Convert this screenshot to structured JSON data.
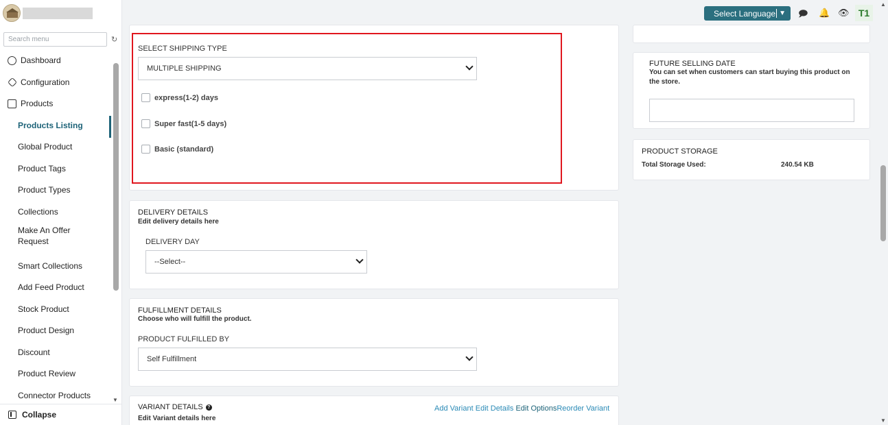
{
  "sidebar": {
    "search_placeholder": "Search menu",
    "items": [
      {
        "label": "Dashboard",
        "icon": "dashboard-icon"
      },
      {
        "label": "Configuration",
        "icon": "configuration-icon"
      },
      {
        "label": "Products",
        "icon": "products-icon"
      },
      {
        "label": "Products Listing",
        "active": true
      },
      {
        "label": "Global Product"
      },
      {
        "label": "Product Tags"
      },
      {
        "label": "Product Types"
      },
      {
        "label": "Collections"
      },
      {
        "label": "Make An Offer Request"
      },
      {
        "label": "Smart Collections"
      },
      {
        "label": "Add Feed Product"
      },
      {
        "label": "Stock Product"
      },
      {
        "label": "Product Design"
      },
      {
        "label": "Discount"
      },
      {
        "label": "Product Review"
      },
      {
        "label": "Connector Products"
      }
    ],
    "collapse_label": "Collapse"
  },
  "topbar": {
    "language_button": "Select Language",
    "avatar_initials": "T1"
  },
  "shipping": {
    "label": "SELECT SHIPPING TYPE",
    "selected": "MULTIPLE SHIPPING",
    "options": [
      {
        "label": "express(1-2) days",
        "checked": false
      },
      {
        "label": "Super fast(1-5 days)",
        "checked": false
      },
      {
        "label": "Basic (standard)",
        "checked": false
      }
    ]
  },
  "delivery": {
    "title": "DELIVERY DETAILS",
    "subtitle": "Edit delivery details here",
    "day_label": "DELIVERY DAY",
    "day_selected": "--Select--"
  },
  "fulfillment": {
    "title": "FULFILLMENT DETAILS",
    "subtitle": "Choose who will fulfill the product.",
    "by_label": "PRODUCT FULFILLED BY",
    "by_selected": "Self Fulfillment"
  },
  "variant": {
    "title": "VARIANT DETAILS",
    "subtitle": "Edit Variant details here",
    "add_variant": "Add Variant",
    "edit_details": "Edit Details",
    "edit_options": "Edit Options",
    "reorder_variant": "Reorder Variant"
  },
  "future_selling": {
    "title": "FUTURE SELLING DATE",
    "description": "You can set when customers can start buying this product on the store.",
    "date_value": ""
  },
  "storage": {
    "title": "PRODUCT STORAGE",
    "used_label": "Total Storage Used:",
    "used_value": "240.54 KB"
  },
  "colors": {
    "accent": "#1d6378",
    "button": "#2b6f7f",
    "highlight_border": "#e0161e",
    "link": "#2a8ab6"
  }
}
